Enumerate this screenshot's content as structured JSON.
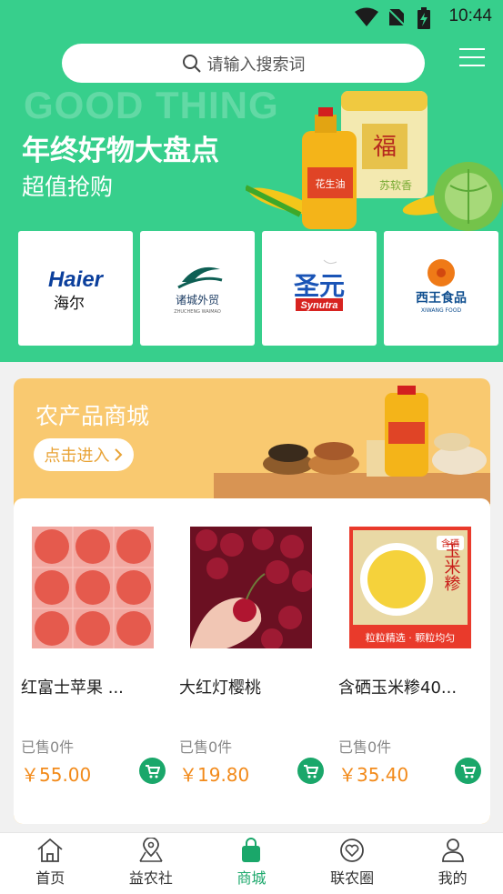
{
  "status_bar": {
    "time": "10:44"
  },
  "search": {
    "placeholder": "请输入搜索词"
  },
  "banner": {
    "watermark": "GOOD THING",
    "headline": "年终好物大盘点",
    "subline": "超值抢购",
    "package_texts": [
      "花生油",
      "苏软香",
      "福"
    ]
  },
  "brands": [
    {
      "name": "Haier",
      "subtitle": "海尔"
    },
    {
      "name": "诸城外贸",
      "subtitle": "ZHUCHENG WAIMAO"
    },
    {
      "name": "圣元",
      "subtitle": "Synutra"
    },
    {
      "name": "西王食品",
      "subtitle": "XIWANG FOOD"
    }
  ],
  "market": {
    "title": "农产品商城",
    "enter_label": "点击进入",
    "products": [
      {
        "name": "红富士苹果 ...",
        "sold": "已售0件",
        "price": "￥55.00"
      },
      {
        "name": "大红灯樱桃",
        "sold": "已售0件",
        "price": "￥19.80"
      },
      {
        "name": "含硒玉米糁40...",
        "sold": "已售0件",
        "price": "￥35.40"
      }
    ],
    "product3_img_texts": {
      "tag": "含硒",
      "title": "玉米糁",
      "slogan": "粒粒精选 · 颗粒均匀"
    }
  },
  "nav": {
    "active_index": 2,
    "items": [
      {
        "label": "首页",
        "icon": "home-icon"
      },
      {
        "label": "益农社",
        "icon": "map-pin-icon"
      },
      {
        "label": "商城",
        "icon": "shopping-bag-icon"
      },
      {
        "label": "联农圈",
        "icon": "heart-chat-icon"
      },
      {
        "label": "我的",
        "icon": "user-icon"
      }
    ]
  },
  "colors": {
    "primary": "#37cf8c",
    "accent": "#1aa76a",
    "price": "#f28a1a",
    "market_banner": "#f9c970"
  }
}
